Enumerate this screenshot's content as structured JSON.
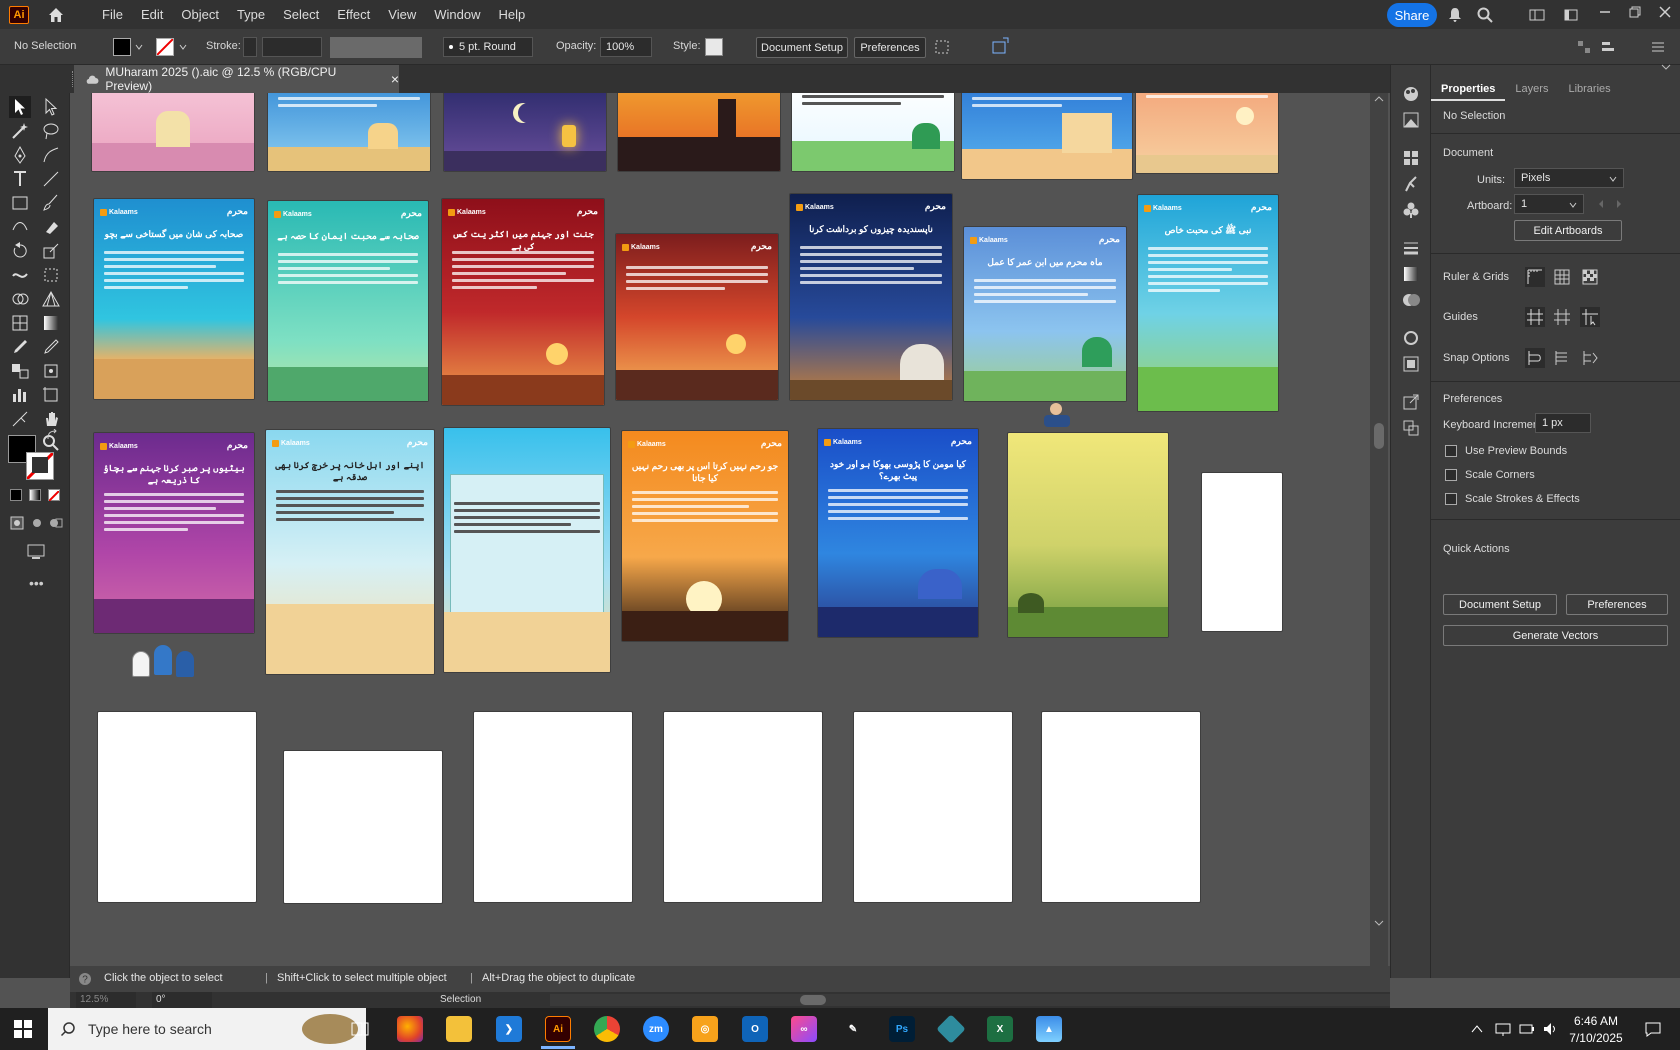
{
  "app": {
    "logo": "Ai",
    "menus": [
      "File",
      "Edit",
      "Object",
      "Type",
      "Select",
      "Effect",
      "View",
      "Window",
      "Help"
    ],
    "share_label": "Share"
  },
  "control_bar": {
    "selection": "No Selection",
    "stroke_label": "Stroke:",
    "brush": "5 pt. Round",
    "opacity_label": "Opacity:",
    "opacity_value": "100%",
    "style_label": "Style:",
    "document_setup": "Document Setup",
    "preferences": "Preferences"
  },
  "document_tab": {
    "title": "MUharam 2025 ().aic @ 12.5 % (RGB/CPU Preview)",
    "close": "×"
  },
  "canvas": {
    "artboards": [
      {
        "title": "",
        "theme": "pink"
      },
      {
        "title": "",
        "theme": "blue"
      },
      {
        "title": "",
        "theme": "night"
      },
      {
        "title": "",
        "theme": "sunset"
      },
      {
        "title": "",
        "theme": "green"
      },
      {
        "title": "",
        "theme": "beach"
      },
      {
        "title": "",
        "theme": "red"
      },
      {
        "title": "صحابہ کی شان میں گستاخی سے بچو",
        "theme": "teal"
      },
      {
        "title": "صحابہ سے محبت ایمان کا حصہ ہے",
        "theme": "mint"
      },
      {
        "title": "جنت اور جہنم میں اکثر یت کس کی ہے",
        "theme": "maroon"
      },
      {
        "title": "",
        "theme": "dusk"
      },
      {
        "title": "ناپسندیدہ چیزوں کو برداشت کرنا",
        "theme": "navy"
      },
      {
        "title": "ماہ محرم میں ابن عمر کا عمل",
        "theme": "sky"
      },
      {
        "title": "نبی ﷺ کی محبت خاص",
        "theme": "cyan"
      },
      {
        "title": "بیٹیوں پر صبر کرنا جہنم سے بچاؤ کا ذریعہ ہے",
        "theme": "purple"
      },
      {
        "title": "اپنے اور اہل خانہ پر خرچ کرنا بھی صدقہ ہے",
        "theme": "lightblue"
      },
      {
        "title": "",
        "theme": "lightblue2"
      },
      {
        "title": "جو رحم نہیں کرتا اس پر بھی رحم نہیں کیا جاتا",
        "theme": "orange"
      },
      {
        "title": "کیا مومن کا پڑوسی بھوکا ہو اور خود پیٹ بھرے؟",
        "theme": "blue2"
      },
      {
        "title": "",
        "theme": "meadow"
      }
    ],
    "logo_text": "Kalaams",
    "tag_text": "محرم"
  },
  "properties_panel": {
    "tabs": [
      "Properties",
      "Layers",
      "Libraries"
    ],
    "selection": "No Selection",
    "document_heading": "Document",
    "units_label": "Units:",
    "units_value": "Pixels",
    "artboard_label": "Artboard:",
    "artboard_value": "1",
    "edit_artboards": "Edit Artboards",
    "ruler_grids": "Ruler & Grids",
    "guides": "Guides",
    "snap_options": "Snap Options",
    "preferences_heading": "Preferences",
    "keyboard_increment_label": "Keyboard Increment:",
    "keyboard_increment_value": "1 px",
    "use_preview_bounds": "Use Preview Bounds",
    "scale_corners": "Scale Corners",
    "scale_strokes": "Scale Strokes & Effects",
    "quick_actions": "Quick Actions",
    "document_setup": "Document Setup",
    "preferences": "Preferences",
    "generate_vectors": "Generate Vectors"
  },
  "status": {
    "hint_click": "Click the object to select",
    "hint_shift": "Shift+Click to select multiple object",
    "hint_alt": "Alt+Drag the object to duplicate",
    "zoom": "12.5%",
    "rotation": "0°",
    "tool": "Selection"
  },
  "taskbar": {
    "search_placeholder": "Type here to search",
    "time": "6:46 AM",
    "date": "7/10/2025"
  },
  "colors": {
    "accent": "#1473e6",
    "ai_orange": "#ff9a00"
  }
}
